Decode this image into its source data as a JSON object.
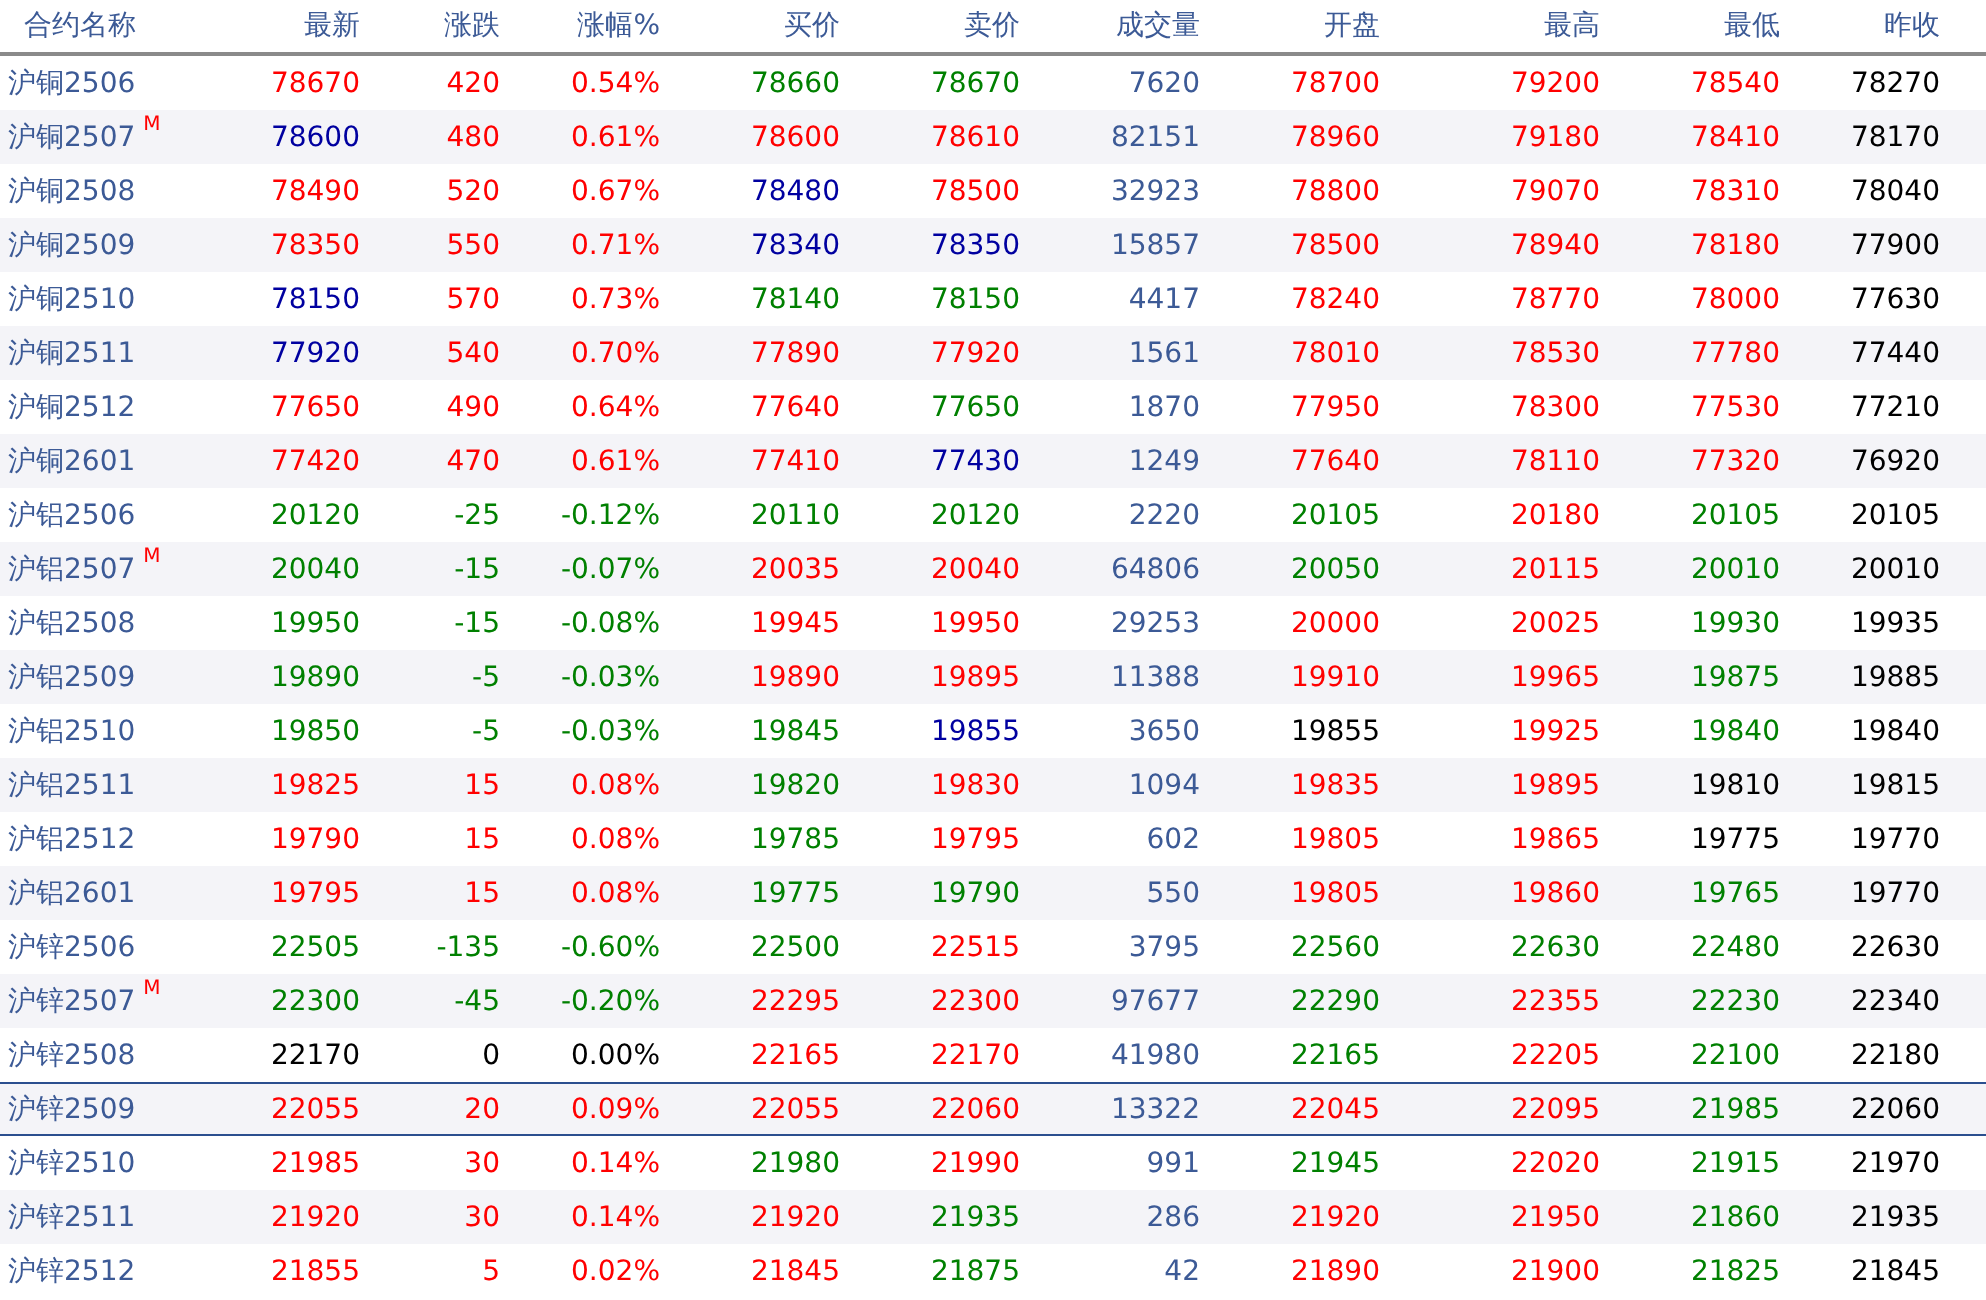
{
  "table": {
    "columns": [
      "合约名称",
      "最新",
      "涨跌",
      "涨幅%",
      "买价",
      "卖价",
      "成交量",
      "开盘",
      "最高",
      "最低",
      "昨收"
    ],
    "rows": [
      {
        "selected": false,
        "cells": [
          {
            "kind": "name",
            "text": "沪铜2506"
          },
          {
            "text": "78670",
            "color": "#ff0000"
          },
          {
            "text": "420",
            "color": "#ff0000"
          },
          {
            "text": "0.54%",
            "color": "#ff0000"
          },
          {
            "text": "78660",
            "color": "#008000"
          },
          {
            "text": "78670",
            "color": "#008000"
          },
          {
            "text": "7620",
            "color": "#3c5a96"
          },
          {
            "text": "78700",
            "color": "#ff0000"
          },
          {
            "text": "79200",
            "color": "#ff0000"
          },
          {
            "text": "78540",
            "color": "#ff0000"
          },
          {
            "text": "78270",
            "color": "#000000"
          }
        ]
      },
      {
        "selected": false,
        "cells": [
          {
            "kind": "name",
            "text": "沪铜2507",
            "badge": "M"
          },
          {
            "text": "78600",
            "color": "#0000a0"
          },
          {
            "text": "480",
            "color": "#ff0000"
          },
          {
            "text": "0.61%",
            "color": "#ff0000"
          },
          {
            "text": "78600",
            "color": "#ff0000"
          },
          {
            "text": "78610",
            "color": "#ff0000"
          },
          {
            "text": "82151",
            "color": "#3c5a96"
          },
          {
            "text": "78960",
            "color": "#ff0000"
          },
          {
            "text": "79180",
            "color": "#ff0000"
          },
          {
            "text": "78410",
            "color": "#ff0000"
          },
          {
            "text": "78170",
            "color": "#000000"
          }
        ]
      },
      {
        "selected": false,
        "cells": [
          {
            "kind": "name",
            "text": "沪铜2508"
          },
          {
            "text": "78490",
            "color": "#ff0000"
          },
          {
            "text": "520",
            "color": "#ff0000"
          },
          {
            "text": "0.67%",
            "color": "#ff0000"
          },
          {
            "text": "78480",
            "color": "#0000a0"
          },
          {
            "text": "78500",
            "color": "#ff0000"
          },
          {
            "text": "32923",
            "color": "#3c5a96"
          },
          {
            "text": "78800",
            "color": "#ff0000"
          },
          {
            "text": "79070",
            "color": "#ff0000"
          },
          {
            "text": "78310",
            "color": "#ff0000"
          },
          {
            "text": "78040",
            "color": "#000000"
          }
        ]
      },
      {
        "selected": false,
        "cells": [
          {
            "kind": "name",
            "text": "沪铜2509"
          },
          {
            "text": "78350",
            "color": "#ff0000"
          },
          {
            "text": "550",
            "color": "#ff0000"
          },
          {
            "text": "0.71%",
            "color": "#ff0000"
          },
          {
            "text": "78340",
            "color": "#0000a0"
          },
          {
            "text": "78350",
            "color": "#0000a0"
          },
          {
            "text": "15857",
            "color": "#3c5a96"
          },
          {
            "text": "78500",
            "color": "#ff0000"
          },
          {
            "text": "78940",
            "color": "#ff0000"
          },
          {
            "text": "78180",
            "color": "#ff0000"
          },
          {
            "text": "77900",
            "color": "#000000"
          }
        ]
      },
      {
        "selected": false,
        "cells": [
          {
            "kind": "name",
            "text": "沪铜2510"
          },
          {
            "text": "78150",
            "color": "#0000a0"
          },
          {
            "text": "570",
            "color": "#ff0000"
          },
          {
            "text": "0.73%",
            "color": "#ff0000"
          },
          {
            "text": "78140",
            "color": "#008000"
          },
          {
            "text": "78150",
            "color": "#008000"
          },
          {
            "text": "4417",
            "color": "#3c5a96"
          },
          {
            "text": "78240",
            "color": "#ff0000"
          },
          {
            "text": "78770",
            "color": "#ff0000"
          },
          {
            "text": "78000",
            "color": "#ff0000"
          },
          {
            "text": "77630",
            "color": "#000000"
          }
        ]
      },
      {
        "selected": false,
        "cells": [
          {
            "kind": "name",
            "text": "沪铜2511"
          },
          {
            "text": "77920",
            "color": "#0000a0"
          },
          {
            "text": "540",
            "color": "#ff0000"
          },
          {
            "text": "0.70%",
            "color": "#ff0000"
          },
          {
            "text": "77890",
            "color": "#ff0000"
          },
          {
            "text": "77920",
            "color": "#ff0000"
          },
          {
            "text": "1561",
            "color": "#3c5a96"
          },
          {
            "text": "78010",
            "color": "#ff0000"
          },
          {
            "text": "78530",
            "color": "#ff0000"
          },
          {
            "text": "77780",
            "color": "#ff0000"
          },
          {
            "text": "77440",
            "color": "#000000"
          }
        ]
      },
      {
        "selected": false,
        "cells": [
          {
            "kind": "name",
            "text": "沪铜2512"
          },
          {
            "text": "77650",
            "color": "#ff0000"
          },
          {
            "text": "490",
            "color": "#ff0000"
          },
          {
            "text": "0.64%",
            "color": "#ff0000"
          },
          {
            "text": "77640",
            "color": "#ff0000"
          },
          {
            "text": "77650",
            "color": "#008000"
          },
          {
            "text": "1870",
            "color": "#3c5a96"
          },
          {
            "text": "77950",
            "color": "#ff0000"
          },
          {
            "text": "78300",
            "color": "#ff0000"
          },
          {
            "text": "77530",
            "color": "#ff0000"
          },
          {
            "text": "77210",
            "color": "#000000"
          }
        ]
      },
      {
        "selected": false,
        "cells": [
          {
            "kind": "name",
            "text": "沪铜2601"
          },
          {
            "text": "77420",
            "color": "#ff0000"
          },
          {
            "text": "470",
            "color": "#ff0000"
          },
          {
            "text": "0.61%",
            "color": "#ff0000"
          },
          {
            "text": "77410",
            "color": "#ff0000"
          },
          {
            "text": "77430",
            "color": "#0000a0"
          },
          {
            "text": "1249",
            "color": "#3c5a96"
          },
          {
            "text": "77640",
            "color": "#ff0000"
          },
          {
            "text": "78110",
            "color": "#ff0000"
          },
          {
            "text": "77320",
            "color": "#ff0000"
          },
          {
            "text": "76920",
            "color": "#000000"
          }
        ]
      },
      {
        "selected": false,
        "cells": [
          {
            "kind": "name",
            "text": "沪铝2506"
          },
          {
            "text": "20120",
            "color": "#008000"
          },
          {
            "text": "-25",
            "color": "#008000"
          },
          {
            "text": "-0.12%",
            "color": "#008000"
          },
          {
            "text": "20110",
            "color": "#008000"
          },
          {
            "text": "20120",
            "color": "#008000"
          },
          {
            "text": "2220",
            "color": "#3c5a96"
          },
          {
            "text": "20105",
            "color": "#008000"
          },
          {
            "text": "20180",
            "color": "#ff0000"
          },
          {
            "text": "20105",
            "color": "#008000"
          },
          {
            "text": "20105",
            "color": "#000000"
          }
        ]
      },
      {
        "selected": false,
        "cells": [
          {
            "kind": "name",
            "text": "沪铝2507",
            "badge": "M"
          },
          {
            "text": "20040",
            "color": "#008000"
          },
          {
            "text": "-15",
            "color": "#008000"
          },
          {
            "text": "-0.07%",
            "color": "#008000"
          },
          {
            "text": "20035",
            "color": "#ff0000"
          },
          {
            "text": "20040",
            "color": "#ff0000"
          },
          {
            "text": "64806",
            "color": "#3c5a96"
          },
          {
            "text": "20050",
            "color": "#008000"
          },
          {
            "text": "20115",
            "color": "#ff0000"
          },
          {
            "text": "20010",
            "color": "#008000"
          },
          {
            "text": "20010",
            "color": "#000000"
          }
        ]
      },
      {
        "selected": false,
        "cells": [
          {
            "kind": "name",
            "text": "沪铝2508"
          },
          {
            "text": "19950",
            "color": "#008000"
          },
          {
            "text": "-15",
            "color": "#008000"
          },
          {
            "text": "-0.08%",
            "color": "#008000"
          },
          {
            "text": "19945",
            "color": "#ff0000"
          },
          {
            "text": "19950",
            "color": "#ff0000"
          },
          {
            "text": "29253",
            "color": "#3c5a96"
          },
          {
            "text": "20000",
            "color": "#ff0000"
          },
          {
            "text": "20025",
            "color": "#ff0000"
          },
          {
            "text": "19930",
            "color": "#008000"
          },
          {
            "text": "19935",
            "color": "#000000"
          }
        ]
      },
      {
        "selected": false,
        "cells": [
          {
            "kind": "name",
            "text": "沪铝2509"
          },
          {
            "text": "19890",
            "color": "#008000"
          },
          {
            "text": "-5",
            "color": "#008000"
          },
          {
            "text": "-0.03%",
            "color": "#008000"
          },
          {
            "text": "19890",
            "color": "#ff0000"
          },
          {
            "text": "19895",
            "color": "#ff0000"
          },
          {
            "text": "11388",
            "color": "#3c5a96"
          },
          {
            "text": "19910",
            "color": "#ff0000"
          },
          {
            "text": "19965",
            "color": "#ff0000"
          },
          {
            "text": "19875",
            "color": "#008000"
          },
          {
            "text": "19885",
            "color": "#000000"
          }
        ]
      },
      {
        "selected": false,
        "cells": [
          {
            "kind": "name",
            "text": "沪铝2510"
          },
          {
            "text": "19850",
            "color": "#008000"
          },
          {
            "text": "-5",
            "color": "#008000"
          },
          {
            "text": "-0.03%",
            "color": "#008000"
          },
          {
            "text": "19845",
            "color": "#008000"
          },
          {
            "text": "19855",
            "color": "#0000a0"
          },
          {
            "text": "3650",
            "color": "#3c5a96"
          },
          {
            "text": "19855",
            "color": "#000000"
          },
          {
            "text": "19925",
            "color": "#ff0000"
          },
          {
            "text": "19840",
            "color": "#008000"
          },
          {
            "text": "19840",
            "color": "#000000"
          }
        ]
      },
      {
        "selected": false,
        "cells": [
          {
            "kind": "name",
            "text": "沪铝2511"
          },
          {
            "text": "19825",
            "color": "#ff0000"
          },
          {
            "text": "15",
            "color": "#ff0000"
          },
          {
            "text": "0.08%",
            "color": "#ff0000"
          },
          {
            "text": "19820",
            "color": "#008000"
          },
          {
            "text": "19830",
            "color": "#ff0000"
          },
          {
            "text": "1094",
            "color": "#3c5a96"
          },
          {
            "text": "19835",
            "color": "#ff0000"
          },
          {
            "text": "19895",
            "color": "#ff0000"
          },
          {
            "text": "19810",
            "color": "#000000"
          },
          {
            "text": "19815",
            "color": "#000000"
          }
        ]
      },
      {
        "selected": false,
        "cells": [
          {
            "kind": "name",
            "text": "沪铝2512"
          },
          {
            "text": "19790",
            "color": "#ff0000"
          },
          {
            "text": "15",
            "color": "#ff0000"
          },
          {
            "text": "0.08%",
            "color": "#ff0000"
          },
          {
            "text": "19785",
            "color": "#008000"
          },
          {
            "text": "19795",
            "color": "#ff0000"
          },
          {
            "text": "602",
            "color": "#3c5a96"
          },
          {
            "text": "19805",
            "color": "#ff0000"
          },
          {
            "text": "19865",
            "color": "#ff0000"
          },
          {
            "text": "19775",
            "color": "#000000"
          },
          {
            "text": "19770",
            "color": "#000000"
          }
        ]
      },
      {
        "selected": false,
        "cells": [
          {
            "kind": "name",
            "text": "沪铝2601"
          },
          {
            "text": "19795",
            "color": "#ff0000"
          },
          {
            "text": "15",
            "color": "#ff0000"
          },
          {
            "text": "0.08%",
            "color": "#ff0000"
          },
          {
            "text": "19775",
            "color": "#008000"
          },
          {
            "text": "19790",
            "color": "#008000"
          },
          {
            "text": "550",
            "color": "#3c5a96"
          },
          {
            "text": "19805",
            "color": "#ff0000"
          },
          {
            "text": "19860",
            "color": "#ff0000"
          },
          {
            "text": "19765",
            "color": "#008000"
          },
          {
            "text": "19770",
            "color": "#000000"
          }
        ]
      },
      {
        "selected": false,
        "cells": [
          {
            "kind": "name",
            "text": "沪锌2506"
          },
          {
            "text": "22505",
            "color": "#008000"
          },
          {
            "text": "-135",
            "color": "#008000"
          },
          {
            "text": "-0.60%",
            "color": "#008000"
          },
          {
            "text": "22500",
            "color": "#008000"
          },
          {
            "text": "22515",
            "color": "#ff0000"
          },
          {
            "text": "3795",
            "color": "#3c5a96"
          },
          {
            "text": "22560",
            "color": "#008000"
          },
          {
            "text": "22630",
            "color": "#008000"
          },
          {
            "text": "22480",
            "color": "#008000"
          },
          {
            "text": "22630",
            "color": "#000000"
          }
        ]
      },
      {
        "selected": false,
        "cells": [
          {
            "kind": "name",
            "text": "沪锌2507",
            "badge": "M"
          },
          {
            "text": "22300",
            "color": "#008000"
          },
          {
            "text": "-45",
            "color": "#008000"
          },
          {
            "text": "-0.20%",
            "color": "#008000"
          },
          {
            "text": "22295",
            "color": "#ff0000"
          },
          {
            "text": "22300",
            "color": "#ff0000"
          },
          {
            "text": "97677",
            "color": "#3c5a96"
          },
          {
            "text": "22290",
            "color": "#008000"
          },
          {
            "text": "22355",
            "color": "#ff0000"
          },
          {
            "text": "22230",
            "color": "#008000"
          },
          {
            "text": "22340",
            "color": "#000000"
          }
        ]
      },
      {
        "selected": false,
        "cells": [
          {
            "kind": "name",
            "text": "沪锌2508"
          },
          {
            "text": "22170",
            "color": "#000000"
          },
          {
            "text": "0",
            "color": "#000000"
          },
          {
            "text": "0.00%",
            "color": "#000000"
          },
          {
            "text": "22165",
            "color": "#ff0000"
          },
          {
            "text": "22170",
            "color": "#ff0000"
          },
          {
            "text": "41980",
            "color": "#3c5a96"
          },
          {
            "text": "22165",
            "color": "#008000"
          },
          {
            "text": "22205",
            "color": "#ff0000"
          },
          {
            "text": "22100",
            "color": "#008000"
          },
          {
            "text": "22180",
            "color": "#000000"
          }
        ]
      },
      {
        "selected": true,
        "cells": [
          {
            "kind": "name",
            "text": "沪锌2509"
          },
          {
            "text": "22055",
            "color": "#ff0000"
          },
          {
            "text": "20",
            "color": "#ff0000"
          },
          {
            "text": "0.09%",
            "color": "#ff0000"
          },
          {
            "text": "22055",
            "color": "#ff0000"
          },
          {
            "text": "22060",
            "color": "#ff0000"
          },
          {
            "text": "13322",
            "color": "#3c5a96"
          },
          {
            "text": "22045",
            "color": "#ff0000"
          },
          {
            "text": "22095",
            "color": "#ff0000"
          },
          {
            "text": "21985",
            "color": "#008000"
          },
          {
            "text": "22060",
            "color": "#000000"
          }
        ]
      },
      {
        "selected": false,
        "cells": [
          {
            "kind": "name",
            "text": "沪锌2510"
          },
          {
            "text": "21985",
            "color": "#ff0000"
          },
          {
            "text": "30",
            "color": "#ff0000"
          },
          {
            "text": "0.14%",
            "color": "#ff0000"
          },
          {
            "text": "21980",
            "color": "#008000"
          },
          {
            "text": "21990",
            "color": "#ff0000"
          },
          {
            "text": "991",
            "color": "#3c5a96"
          },
          {
            "text": "21945",
            "color": "#008000"
          },
          {
            "text": "22020",
            "color": "#ff0000"
          },
          {
            "text": "21915",
            "color": "#008000"
          },
          {
            "text": "21970",
            "color": "#000000"
          }
        ]
      },
      {
        "selected": false,
        "cells": [
          {
            "kind": "name",
            "text": "沪锌2511"
          },
          {
            "text": "21920",
            "color": "#ff0000"
          },
          {
            "text": "30",
            "color": "#ff0000"
          },
          {
            "text": "0.14%",
            "color": "#ff0000"
          },
          {
            "text": "21920",
            "color": "#ff0000"
          },
          {
            "text": "21935",
            "color": "#008000"
          },
          {
            "text": "286",
            "color": "#3c5a96"
          },
          {
            "text": "21920",
            "color": "#ff0000"
          },
          {
            "text": "21950",
            "color": "#ff0000"
          },
          {
            "text": "21860",
            "color": "#008000"
          },
          {
            "text": "21935",
            "color": "#000000"
          }
        ]
      },
      {
        "selected": false,
        "cells": [
          {
            "kind": "name",
            "text": "沪锌2512"
          },
          {
            "text": "21855",
            "color": "#ff0000"
          },
          {
            "text": "5",
            "color": "#ff0000"
          },
          {
            "text": "0.02%",
            "color": "#ff0000"
          },
          {
            "text": "21845",
            "color": "#ff0000"
          },
          {
            "text": "21875",
            "color": "#008000"
          },
          {
            "text": "42",
            "color": "#3c5a96"
          },
          {
            "text": "21890",
            "color": "#ff0000"
          },
          {
            "text": "21900",
            "color": "#ff0000"
          },
          {
            "text": "21825",
            "color": "#008000"
          },
          {
            "text": "21845",
            "color": "#000000"
          }
        ]
      }
    ]
  }
}
